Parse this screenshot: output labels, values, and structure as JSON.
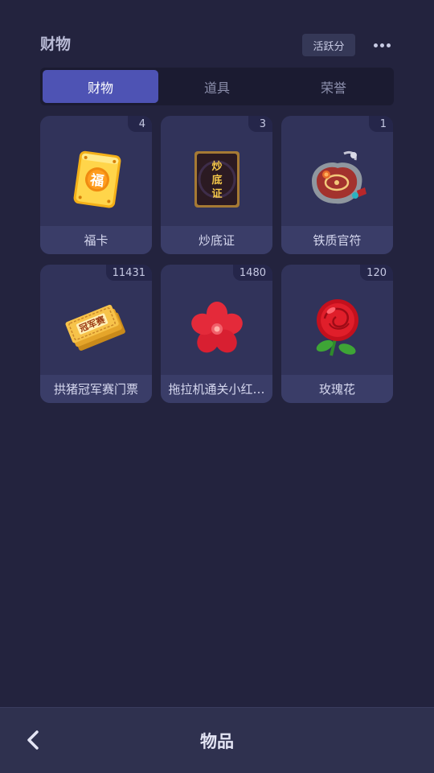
{
  "header": {
    "title": "财物",
    "activity_label": "活跃分",
    "more_icon": "more-icon"
  },
  "tabs": [
    {
      "label": "财物",
      "active": true
    },
    {
      "label": "道具",
      "active": false
    },
    {
      "label": "荣誉",
      "active": false
    }
  ],
  "items": [
    {
      "name": "福卡",
      "count": "4",
      "icon": "fu-card-icon"
    },
    {
      "name": "炒底证",
      "count": "3",
      "icon": "chaodi-certificate-icon"
    },
    {
      "name": "铁质官符",
      "count": "1",
      "icon": "iron-token-icon"
    },
    {
      "name": "拱猪冠军赛门票",
      "count": "11431",
      "icon": "ticket-icon"
    },
    {
      "name": "拖拉机通关小红…",
      "count": "1480",
      "icon": "red-flower-icon"
    },
    {
      "name": "玫瑰花",
      "count": "120",
      "icon": "rose-icon"
    }
  ],
  "bottom_bar": {
    "title": "物品",
    "back_icon": "back-arrow-icon"
  }
}
